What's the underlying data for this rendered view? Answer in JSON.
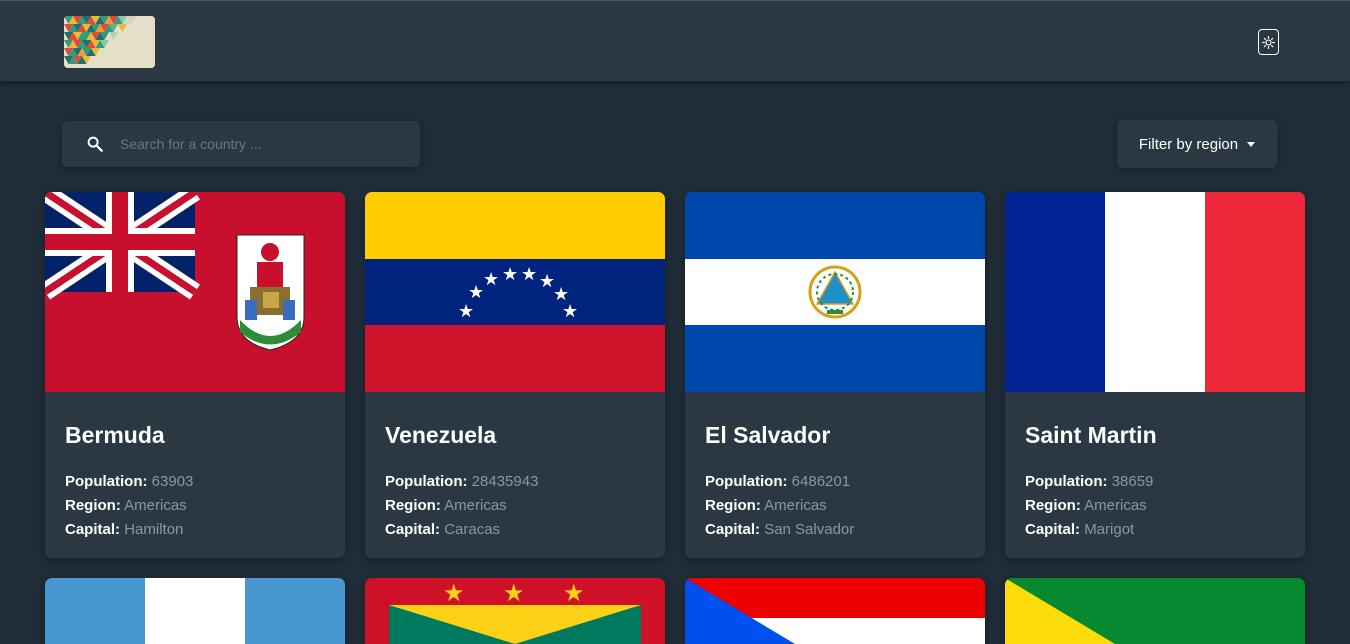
{
  "header": {
    "logo_icon": "geometric-triangles-logo",
    "theme_toggle_icon": "sun-icon"
  },
  "search": {
    "placeholder": "Search for a country ...",
    "icon": "search-icon"
  },
  "filter": {
    "label": "Filter by region",
    "icon": "caret-down-icon"
  },
  "labels": {
    "population": "Population:",
    "region": "Region:",
    "capital": "Capital:"
  },
  "countries": [
    {
      "name": "Bermuda",
      "population": "63903",
      "region": "Americas",
      "capital": "Hamilton"
    },
    {
      "name": "Venezuela",
      "population": "28435943",
      "region": "Americas",
      "capital": "Caracas"
    },
    {
      "name": "El Salvador",
      "population": "6486201",
      "region": "Americas",
      "capital": "San Salvador"
    },
    {
      "name": "Saint Martin",
      "population": "38659",
      "region": "Americas",
      "capital": "Marigot"
    }
  ],
  "colors": {
    "background": "#202c37",
    "elements": "#2b3844",
    "value_text": "#8c96a0"
  }
}
